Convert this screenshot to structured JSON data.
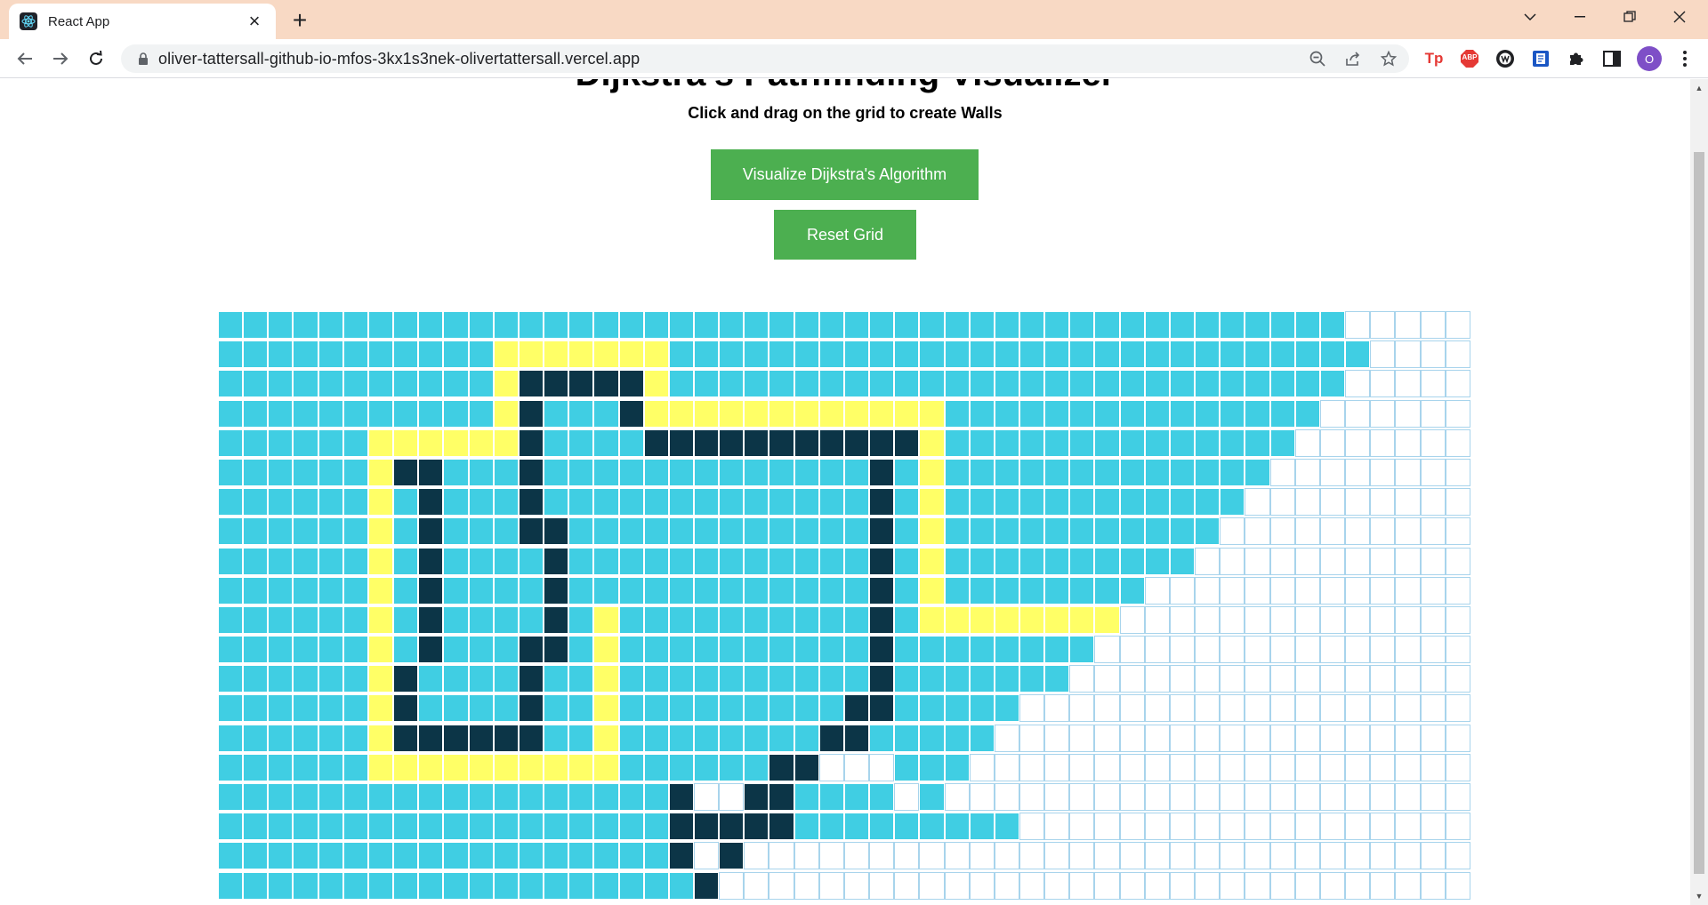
{
  "browser": {
    "tab_title": "React App",
    "url": "oliver-tattersall-github-io-mfos-3kx1s3nek-olivertattersall.vercel.app",
    "profile_initial": "O",
    "ext_tp": "Tp",
    "ext_abp": "ABP"
  },
  "page": {
    "heading_partial": "Dijkstra's Pathfinding Visualizer",
    "subtitle": "Click and drag on the grid to create Walls",
    "visualize_button": "Visualize Dijkstra's Algorithm",
    "reset_button": "Reset Grid"
  },
  "grid": {
    "columns": 50,
    "legend": {
      "v": "visited",
      "p": "shortest-path",
      "w": "wall",
      "e": "empty"
    },
    "rows": [
      "vvvvvvvvvvvvvvvvvvvvvvvvvvvvvvvvvvvvvvvvvvvvveeeee",
      "vvvvvvvvvvvvvvvvvvvvvvvvvvvvvvvvvvvvvvvvvvvvvveeee",
      "vvvvvvvvvvvvvvvvvvvvvvvvvvvvvvvvvvvvvvvvvvvvveeeee",
      "vvvvvvvvvvvvvvvvvvvvvvvvvvvvvvvvvvvvvvvvvvvveeeeee",
      "vvvvvvvvvvvvvvvvvvvvvvvvvvvvvvvvvvvvvvvvvvveeeeeee",
      "vvvvvvvvvvvvvvvvvvvvvvvvvvvvvvvvvvvvvvvvvveeeeeeee",
      "vvvvvvvvvvvvvvvvvvvvvvvvvvvvvvvvvvvvvvvvveeeeeeeee",
      "vvvvvvvvvvvvvvvvvvvvvvvvvvvvvvvvvvvvvvvveeeeeeeeee",
      "vvvvvvvvvvvvvvvvvvvvvvvvvvvvvvvvvvvvvvveeeeeeeeeee",
      "vvvvvvvvvvvvvvvvvvvvvvvvvvvvvvvvvvvvveeeeeeeeeeeee",
      "vvvvvvvvvvvvvvvvvvvvvvvvvvvvvvvvvvvveeeeeeeeeeeeee",
      "vvvvvvvvvvvvvvvvvvvvvvvvvvvvvvvvvvveeeeeeeeeeeeeee",
      "vvvvvvvvvvvvvvvvvvvvvvvvvvvvvvvvvveeeeeeeeeeeeeeee",
      "vvvvvvvvvvvvvvvvvvvvvvvvvvvvvvvveeeeeeeeeeeeeeeeee",
      "vvvvvvvvvvvvvvvvvvvvvvvvvvvvvvveeeeeeeeeeeeeeeeeee",
      "vvvvvvvvvvvvvvvvvvvvvvveeeeeeeeeeeeeeeeeeeeeeeeeee",
      "vvvvvvvvvvvvvvvvvvvvvvvvvvveeeeeeeeeeeeeeeeeeeeeee",
      "vvvvvvvvvvvvvvvvvvvvvvvvvvvvvvvveeeeeeeeeeeeeeeeee",
      "vvvvvvvvvvvvvvvvvvveeeeeeeeeeeeeeeeeeeeeeeeeeeeeee",
      "vvvvvvvvvvvvvvvvvvveeeeeeeeeeeeeeeeeeeeeeeeeeeeeee"
    ],
    "walls": [
      [
        2,
        12
      ],
      [
        2,
        13
      ],
      [
        2,
        14
      ],
      [
        2,
        15
      ],
      [
        2,
        16
      ],
      [
        3,
        12
      ],
      [
        3,
        16
      ],
      [
        4,
        12
      ],
      [
        4,
        17
      ],
      [
        4,
        18
      ],
      [
        4,
        19
      ],
      [
        4,
        20
      ],
      [
        4,
        21
      ],
      [
        4,
        22
      ],
      [
        4,
        23
      ],
      [
        4,
        24
      ],
      [
        4,
        25
      ],
      [
        4,
        26
      ],
      [
        4,
        27
      ],
      [
        5,
        7
      ],
      [
        5,
        8
      ],
      [
        5,
        12
      ],
      [
        5,
        26
      ],
      [
        6,
        8
      ],
      [
        6,
        12
      ],
      [
        6,
        26
      ],
      [
        7,
        8
      ],
      [
        7,
        12
      ],
      [
        7,
        13
      ],
      [
        7,
        26
      ],
      [
        8,
        8
      ],
      [
        8,
        13
      ],
      [
        8,
        26
      ],
      [
        9,
        8
      ],
      [
        9,
        13
      ],
      [
        9,
        26
      ],
      [
        10,
        8
      ],
      [
        10,
        13
      ],
      [
        10,
        26
      ],
      [
        11,
        8
      ],
      [
        11,
        12
      ],
      [
        11,
        13
      ],
      [
        11,
        26
      ],
      [
        12,
        7
      ],
      [
        12,
        12
      ],
      [
        12,
        26
      ],
      [
        13,
        7
      ],
      [
        13,
        12
      ],
      [
        13,
        25
      ],
      [
        13,
        26
      ],
      [
        14,
        7
      ],
      [
        14,
        8
      ],
      [
        14,
        9
      ],
      [
        14,
        10
      ],
      [
        14,
        11
      ],
      [
        14,
        12
      ],
      [
        14,
        24
      ],
      [
        14,
        25
      ],
      [
        15,
        22
      ],
      [
        15,
        23
      ],
      [
        16,
        18
      ],
      [
        16,
        21
      ],
      [
        16,
        22
      ],
      [
        17,
        18
      ],
      [
        17,
        19
      ],
      [
        17,
        20
      ],
      [
        17,
        21
      ],
      [
        17,
        22
      ],
      [
        18,
        18
      ],
      [
        18,
        20
      ],
      [
        19,
        19
      ]
    ],
    "path": [
      [
        1,
        11
      ],
      [
        1,
        12
      ],
      [
        1,
        13
      ],
      [
        1,
        14
      ],
      [
        1,
        15
      ],
      [
        1,
        16
      ],
      [
        1,
        17
      ],
      [
        2,
        11
      ],
      [
        2,
        17
      ],
      [
        3,
        11
      ],
      [
        3,
        17
      ],
      [
        3,
        18
      ],
      [
        3,
        19
      ],
      [
        3,
        20
      ],
      [
        3,
        21
      ],
      [
        3,
        22
      ],
      [
        3,
        23
      ],
      [
        3,
        24
      ],
      [
        3,
        25
      ],
      [
        3,
        26
      ],
      [
        3,
        27
      ],
      [
        3,
        28
      ],
      [
        4,
        6
      ],
      [
        4,
        7
      ],
      [
        4,
        8
      ],
      [
        4,
        9
      ],
      [
        4,
        10
      ],
      [
        4,
        11
      ],
      [
        4,
        28
      ],
      [
        5,
        6
      ],
      [
        5,
        28
      ],
      [
        6,
        6
      ],
      [
        6,
        28
      ],
      [
        7,
        6
      ],
      [
        7,
        28
      ],
      [
        8,
        6
      ],
      [
        8,
        28
      ],
      [
        9,
        6
      ],
      [
        9,
        28
      ],
      [
        10,
        6
      ],
      [
        10,
        15
      ],
      [
        10,
        28
      ],
      [
        10,
        29
      ],
      [
        10,
        30
      ],
      [
        10,
        31
      ],
      [
        10,
        32
      ],
      [
        10,
        33
      ],
      [
        10,
        34
      ],
      [
        10,
        35
      ],
      [
        11,
        6
      ],
      [
        11,
        15
      ],
      [
        12,
        6
      ],
      [
        12,
        15
      ],
      [
        13,
        6
      ],
      [
        13,
        15
      ],
      [
        14,
        6
      ],
      [
        14,
        15
      ],
      [
        15,
        6
      ],
      [
        15,
        7
      ],
      [
        15,
        8
      ],
      [
        15,
        9
      ],
      [
        15,
        10
      ],
      [
        15,
        11
      ],
      [
        15,
        12
      ],
      [
        15,
        13
      ],
      [
        15,
        14
      ],
      [
        15,
        15
      ]
    ],
    "visited_islands": [
      [
        15,
        27
      ],
      [
        15,
        28
      ],
      [
        15,
        29
      ],
      [
        16,
        28
      ]
    ],
    "empty_overrides": [
      [
        16,
        19
      ],
      [
        16,
        20
      ],
      [
        18,
        19
      ]
    ]
  }
}
